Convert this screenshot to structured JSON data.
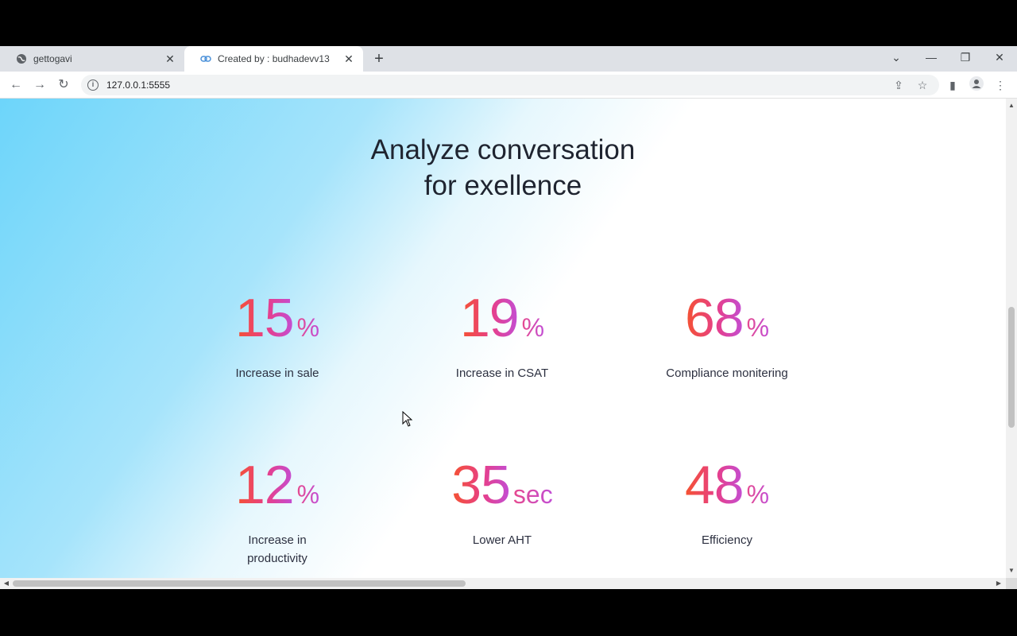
{
  "browser": {
    "tabs": [
      {
        "title": "gettogavi",
        "favicon": "globe-icon"
      },
      {
        "title": "Created by : budhadevv13",
        "favicon": "link-icon"
      }
    ],
    "url": "127.0.0.1:5555"
  },
  "page": {
    "heading_line1": "Analyze conversation",
    "heading_line2": "for exellence",
    "stats": [
      {
        "value": "15",
        "unit": "%",
        "label": "Increase in sale"
      },
      {
        "value": "19",
        "unit": "%",
        "label": "Increase in CSAT"
      },
      {
        "value": "68",
        "unit": "%",
        "label": "Compliance monitering"
      },
      {
        "value": "12",
        "unit": "%",
        "label_line1": "Increase in",
        "label_line2": "productivity"
      },
      {
        "value": "35",
        "unit": "sec",
        "label": "Lower AHT"
      },
      {
        "value": "48",
        "unit": "%",
        "label": "Efficiency"
      }
    ]
  },
  "colors": {
    "gradient_start": "#f5522f",
    "gradient_end": "#c24ed6",
    "hero_bg": "#6dd5fa"
  }
}
